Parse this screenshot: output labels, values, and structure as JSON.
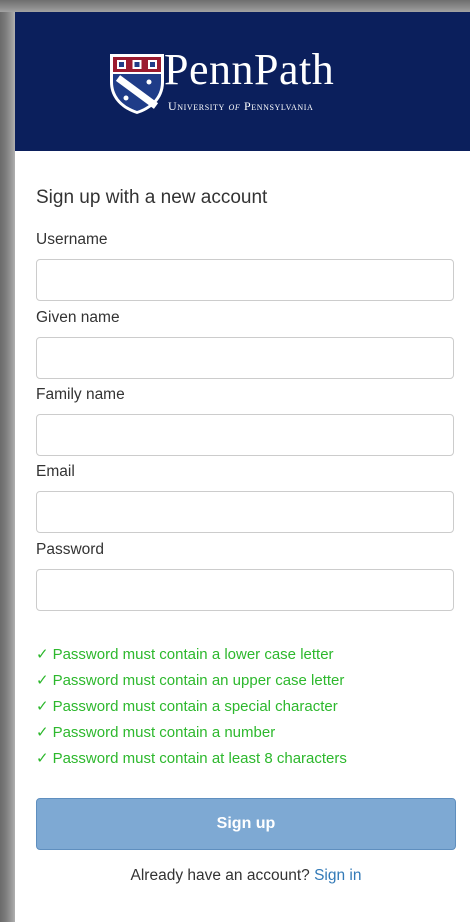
{
  "brand": {
    "title": "PennPath",
    "subtitle_prefix": "University",
    "subtitle_of": "of",
    "subtitle_suffix": "Pennsylvania",
    "banner_color": "#0b1f5c"
  },
  "form": {
    "heading": "Sign up with a new account",
    "fields": [
      {
        "label": "Username",
        "value": "",
        "placeholder": ""
      },
      {
        "label": "Given name",
        "value": "",
        "placeholder": ""
      },
      {
        "label": "Family name",
        "value": "",
        "placeholder": ""
      },
      {
        "label": "Email",
        "value": "",
        "placeholder": ""
      },
      {
        "label": "Password",
        "value": "",
        "placeholder": ""
      }
    ],
    "password_rules": [
      "Password must contain a lower case letter",
      "Password must contain an upper case letter",
      "Password must contain a special character",
      "Password must contain a number",
      "Password must contain at least 8 characters"
    ],
    "rule_check_symbol": "✓",
    "rule_color": "#2db82d",
    "submit_label": "Sign up",
    "submit_color": "#7ea9d3"
  },
  "footer": {
    "prompt": "Already have an account?",
    "link_label": "Sign in",
    "link_color": "#337ab7"
  }
}
